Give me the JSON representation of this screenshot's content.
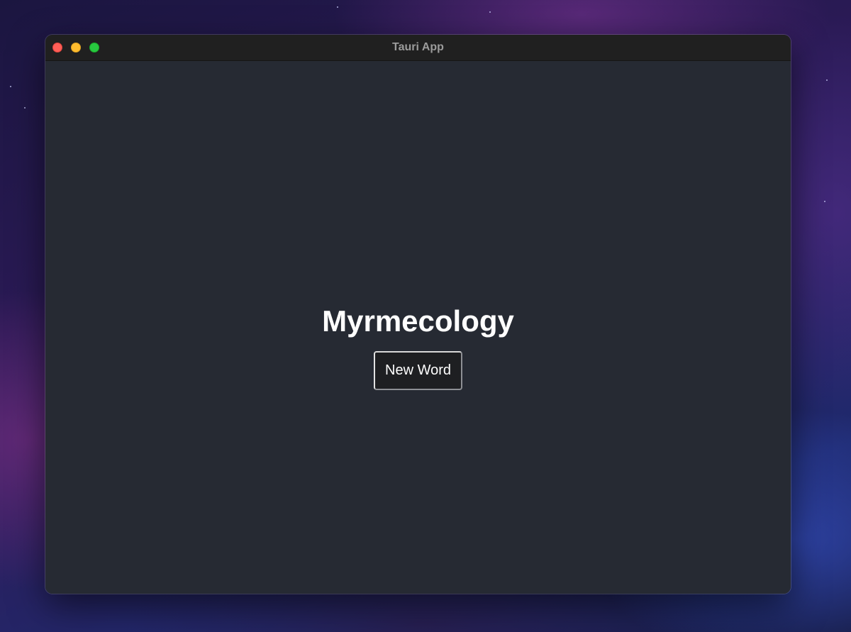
{
  "window": {
    "title": "Tauri App",
    "controls": [
      "close",
      "minimize",
      "zoom"
    ]
  },
  "main": {
    "word": "Myrmecology",
    "button_label": "New Word"
  },
  "colors": {
    "window_bg": "#262a33",
    "titlebar_bg": "#202020",
    "close": "#ff5f57",
    "minimize": "#febc2e",
    "zoom": "#28c840"
  }
}
